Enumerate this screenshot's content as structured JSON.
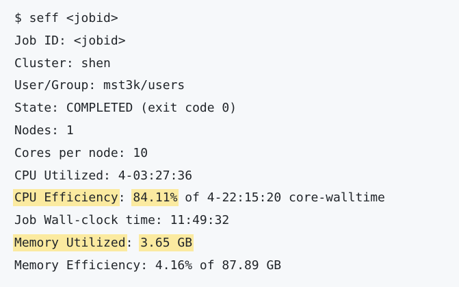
{
  "terminal": {
    "command": "$ seff <jobid>",
    "lines": {
      "job_id": "Job ID: <jobid>",
      "cluster": "Cluster: shen",
      "user_group": "User/Group: mst3k/users",
      "state": "State: COMPLETED (exit code 0)",
      "nodes": "Nodes: 1",
      "cores_per_node": "Cores per node: 10",
      "cpu_utilized": "CPU Utilized: 4-03:27:36",
      "cpu_efficiency": {
        "label": "CPU Efficiency",
        "sep": ": ",
        "value": "84.11%",
        "rest": " of 4-22:15:20 core-walltime"
      },
      "wall_clock": "Job Wall-clock time: 11:49:32",
      "memory_utilized": {
        "label": "Memory Utilized",
        "sep": ": ",
        "value": "3.65 GB"
      },
      "memory_efficiency": "Memory Efficiency: 4.16% of 87.89 GB"
    }
  },
  "colors": {
    "background": "#f6f8fa",
    "text": "#1f2328",
    "highlight": "#fbeaa0"
  }
}
